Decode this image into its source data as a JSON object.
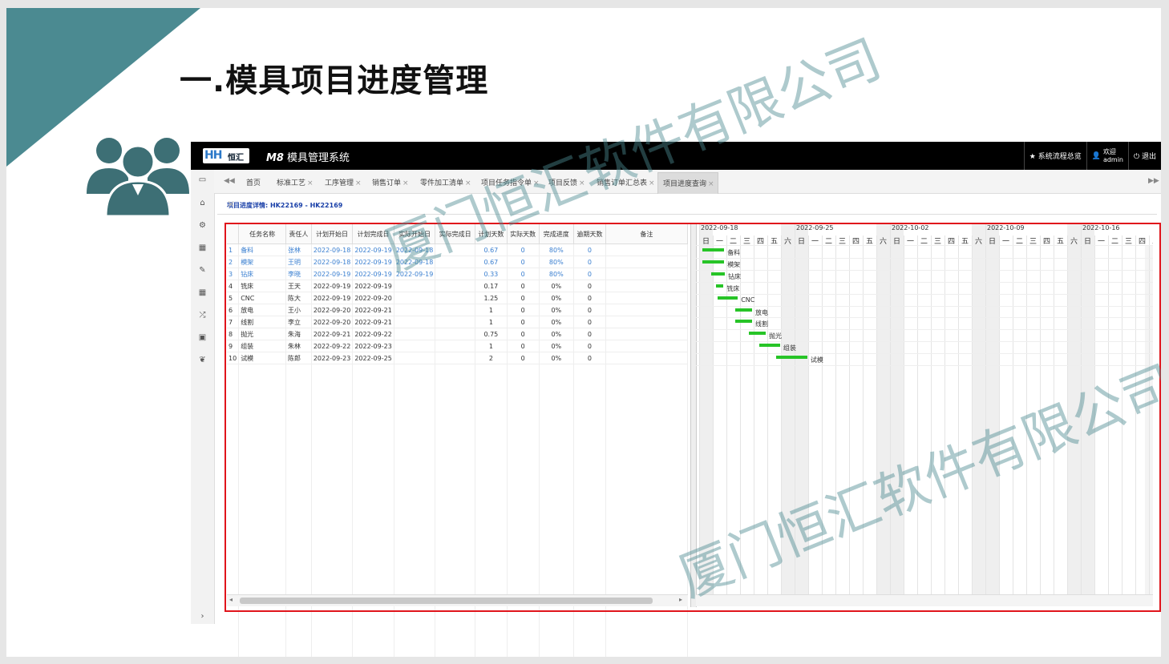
{
  "slide_title": "一.模具项目进度管理",
  "app": {
    "logo_mark": "HH",
    "logo_name": "恒汇",
    "system_name_prefix": "M8",
    "system_name": "模具管理系统",
    "top_links": {
      "flow": "★ 系统流程总览",
      "welcome": "欢迎",
      "user": "admin",
      "logout": "⏻ 退出"
    }
  },
  "tabs": [
    "首页",
    "标准工艺",
    "工序管理",
    "销售订单",
    "零件加工清单",
    "项目任务指令单",
    "项目反馈",
    "销售订单汇总表",
    "项目进度查询"
  ],
  "active_tab": "项目进度查询",
  "breadcrumb": "项目进度详情:  HK22169  -  HK22169",
  "grid": {
    "columns": [
      "任务名称",
      "责任人",
      "计划开始日",
      "计划完成日",
      "实际开始日",
      "实际完成日",
      "计划天数",
      "实际天数",
      "完成进度",
      "逾期天数",
      "备注"
    ],
    "rows": [
      {
        "n": "1",
        "name": "备料",
        "owner": "张林",
        "ps": "2022-09-18",
        "pe": "2022-09-19",
        "as": "2022-09-18",
        "ae": "",
        "pd": "0.67",
        "ad": "0",
        "prog": "80%",
        "od": "0",
        "note": ""
      },
      {
        "n": "2",
        "name": "模架",
        "owner": "王明",
        "ps": "2022-09-18",
        "pe": "2022-09-19",
        "as": "2022-09-18",
        "ae": "",
        "pd": "0.67",
        "ad": "0",
        "prog": "80%",
        "od": "0",
        "note": ""
      },
      {
        "n": "3",
        "name": "钻床",
        "owner": "李晓",
        "ps": "2022-09-19",
        "pe": "2022-09-19",
        "as": "2022-09-19",
        "ae": "",
        "pd": "0.33",
        "ad": "0",
        "prog": "80%",
        "od": "0",
        "note": ""
      },
      {
        "n": "4",
        "name": "铣床",
        "owner": "王天",
        "ps": "2022-09-19",
        "pe": "2022-09-19",
        "as": "",
        "ae": "",
        "pd": "0.17",
        "ad": "0",
        "prog": "0%",
        "od": "0",
        "note": ""
      },
      {
        "n": "5",
        "name": "CNC",
        "owner": "陈大",
        "ps": "2022-09-19",
        "pe": "2022-09-20",
        "as": "",
        "ae": "",
        "pd": "1.25",
        "ad": "0",
        "prog": "0%",
        "od": "0",
        "note": ""
      },
      {
        "n": "6",
        "name": "放电",
        "owner": "王小",
        "ps": "2022-09-20",
        "pe": "2022-09-21",
        "as": "",
        "ae": "",
        "pd": "1",
        "ad": "0",
        "prog": "0%",
        "od": "0",
        "note": ""
      },
      {
        "n": "7",
        "name": "线割",
        "owner": "李立",
        "ps": "2022-09-20",
        "pe": "2022-09-21",
        "as": "",
        "ae": "",
        "pd": "1",
        "ad": "0",
        "prog": "0%",
        "od": "0",
        "note": ""
      },
      {
        "n": "8",
        "name": "抛光",
        "owner": "朱海",
        "ps": "2022-09-21",
        "pe": "2022-09-22",
        "as": "",
        "ae": "",
        "pd": "0.75",
        "ad": "0",
        "prog": "0%",
        "od": "0",
        "note": ""
      },
      {
        "n": "9",
        "name": "组装",
        "owner": "朱林",
        "ps": "2022-09-22",
        "pe": "2022-09-23",
        "as": "",
        "ae": "",
        "pd": "1",
        "ad": "0",
        "prog": "0%",
        "od": "0",
        "note": ""
      },
      {
        "n": "10",
        "name": "试模",
        "owner": "陈郎",
        "ps": "2022-09-23",
        "pe": "2022-09-25",
        "as": "",
        "ae": "",
        "pd": "2",
        "ad": "0",
        "prog": "0%",
        "od": "0",
        "note": ""
      }
    ]
  },
  "gantt": {
    "weeks": [
      "2022-09-18",
      "2022-09-25",
      "2022-10-02",
      "2022-10-09",
      "2022-10-16"
    ],
    "weekdays": [
      "日",
      "一",
      "二",
      "三",
      "四",
      "五",
      "六"
    ],
    "tasks": [
      {
        "label": "备料",
        "start_day": 0.0,
        "duration_days": 1.6
      },
      {
        "label": "模架",
        "start_day": 0.0,
        "duration_days": 1.6
      },
      {
        "label": "钻床",
        "start_day": 0.65,
        "duration_days": 1.0
      },
      {
        "label": "铣床",
        "start_day": 1.0,
        "duration_days": 0.55
      },
      {
        "label": "CNC",
        "start_day": 1.1,
        "duration_days": 1.5
      },
      {
        "label": "放电",
        "start_day": 2.4,
        "duration_days": 1.25
      },
      {
        "label": "线割",
        "start_day": 2.4,
        "duration_days": 1.25
      },
      {
        "label": "抛光",
        "start_day": 3.4,
        "duration_days": 1.25
      },
      {
        "label": "组装",
        "start_day": 4.2,
        "duration_days": 1.5
      },
      {
        "label": "试模",
        "start_day": 5.4,
        "duration_days": 2.3
      }
    ]
  },
  "watermark": "厦门恒汇软件有限公司",
  "colors": {
    "accent": "#4b8a91",
    "highlight": "#e0141b",
    "bar": "#27c427",
    "link": "#3a7fd0"
  }
}
